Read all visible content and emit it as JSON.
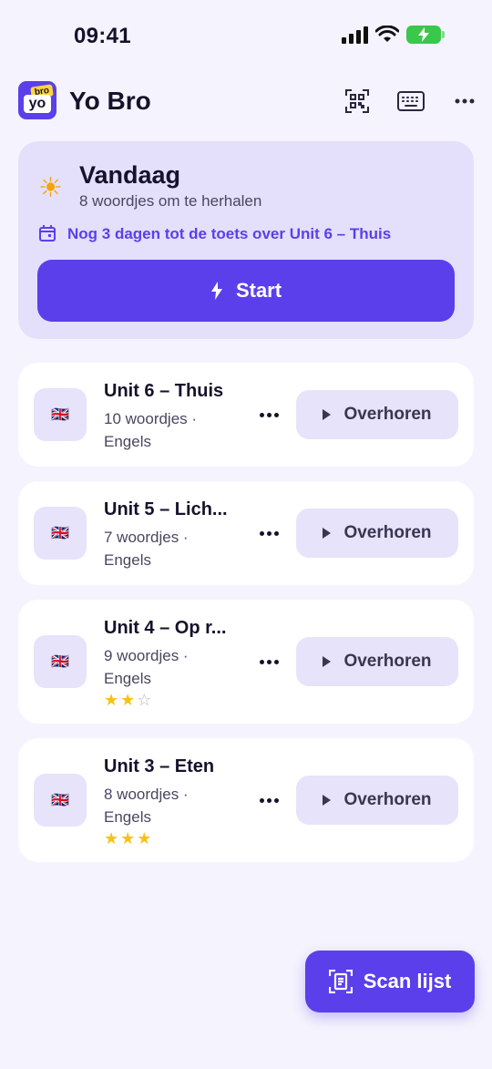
{
  "status": {
    "time": "09:41"
  },
  "header": {
    "app_name": "Yo Bro",
    "logo_top": "bro",
    "logo_bottom": "yo",
    "icons": [
      "qr-code-icon",
      "keyboard-icon",
      "more-horizontal-icon"
    ]
  },
  "today": {
    "title": "Vandaag",
    "subtitle": "8 woordjes om te herhalen",
    "note": "Nog 3 dagen tot de toets over Unit 6 – Thuis",
    "start_label": "Start"
  },
  "units": [
    {
      "title": "Unit 6 – Thuis",
      "meta": "10 woordjes · Engels",
      "flag": "🇬🇧",
      "stars": null,
      "action": "Overhoren"
    },
    {
      "title": "Unit 5 – Lich...",
      "meta": "7 woordjes · Engels",
      "flag": "🇬🇧",
      "stars": null,
      "action": "Overhoren"
    },
    {
      "title": "Unit 4 – Op r...",
      "meta": "9 woordjes · Engels",
      "flag": "🇬🇧",
      "stars": 2,
      "action": "Overhoren"
    },
    {
      "title": "Unit 3 – Eten",
      "meta": "8 woordjes · Engels",
      "flag": "🇬🇧",
      "stars": 3,
      "action": "Overhoren"
    }
  ],
  "scan_button": {
    "label": "Scan lijst"
  },
  "colors": {
    "accent": "#5B3FEA",
    "card_tint": "#E4DFFB",
    "background": "#F5F3FD",
    "star": "#F5C21B"
  }
}
